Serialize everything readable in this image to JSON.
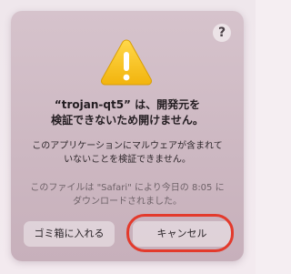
{
  "dialog": {
    "help_label": "?",
    "icon": "warning-triangle-icon",
    "title": "“trojan-qt5” は、開発元を\n検証できないため開けません。",
    "message": "このアプリケーションにマルウェアが含まれて\nいないことを検証できません。",
    "info": "このファイルは \"Safari\" により今日の 8:05 に\nダウンロードされました。",
    "buttons": {
      "move_to_trash": "ゴミ箱に入れる",
      "cancel": "キャンセル"
    }
  },
  "colors": {
    "highlight": "#e33a2c",
    "warning_yellow": "#f6c21a"
  }
}
